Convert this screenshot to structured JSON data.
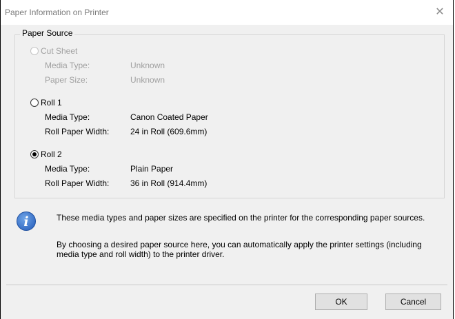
{
  "dialog": {
    "title": "Paper Information on Printer",
    "close_icon": "close-icon"
  },
  "paper_source": {
    "label": "Paper Source",
    "cut_sheet": {
      "label": "Cut Sheet",
      "enabled": false,
      "selected": false,
      "media_type_label": "Media Type:",
      "media_type_value": "Unknown",
      "paper_size_label": "Paper Size:",
      "paper_size_value": "Unknown"
    },
    "roll1": {
      "label": "Roll 1",
      "selected": false,
      "media_type_label": "Media Type:",
      "media_type_value": "Canon Coated Paper",
      "width_label": "Roll Paper Width:",
      "width_value": "24 in Roll (609.6mm)"
    },
    "roll2": {
      "label": "Roll 2",
      "selected": true,
      "media_type_label": "Media Type:",
      "media_type_value": "Plain Paper",
      "width_label": "Roll Paper Width:",
      "width_value": "36 in Roll (914.4mm)"
    }
  },
  "info": {
    "icon": "info-icon",
    "line1": "These media types and paper sizes are specified on the printer for the corresponding paper sources.",
    "line2a": "By choosing a desired paper source here, you can automatically apply the printer settings (including",
    "line2b": "media type and roll width) to the printer driver."
  },
  "buttons": {
    "ok": "OK",
    "cancel": "Cancel"
  }
}
